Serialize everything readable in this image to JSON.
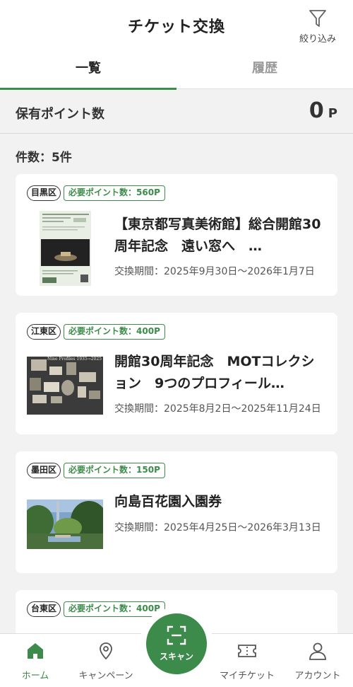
{
  "header": {
    "title": "チケット交換",
    "filter_label": "絞り込み"
  },
  "tabs": [
    {
      "label": "一覧",
      "active": true
    },
    {
      "label": "履歴",
      "active": false
    }
  ],
  "points": {
    "label": "保有ポイント数",
    "value": "0",
    "unit": "P"
  },
  "count_label": "件数：5件",
  "accent_color": "#3d8b4a",
  "cards": [
    {
      "ward": "目黒区",
      "required": "必要ポイント数：560P",
      "title": "【東京都写真美術館】総合開館30周年記念　遠い窓へ　…",
      "period": "交換期間：2025年9月30日～2026年1月7日"
    },
    {
      "ward": "江東区",
      "required": "必要ポイント数：400P",
      "title": "開館30周年記念　MOTコレクション　9つのプロフィール…",
      "period": "交換期間：2025年8月2日～2025年11月24日",
      "thumb_caption": "Nine Profiles 1935→2025"
    },
    {
      "ward": "墨田区",
      "required": "必要ポイント数：150P",
      "title": "向島百花園入園券",
      "period": "交換期間：2025年4月25日～2026年3月13日"
    },
    {
      "ward": "台東区",
      "required": "必要ポイント数：400P"
    }
  ],
  "nav": {
    "home": "ホーム",
    "campaign": "キャンペーン",
    "scan": "スキャン",
    "mytickets": "マイチケット",
    "account": "アカウント"
  }
}
